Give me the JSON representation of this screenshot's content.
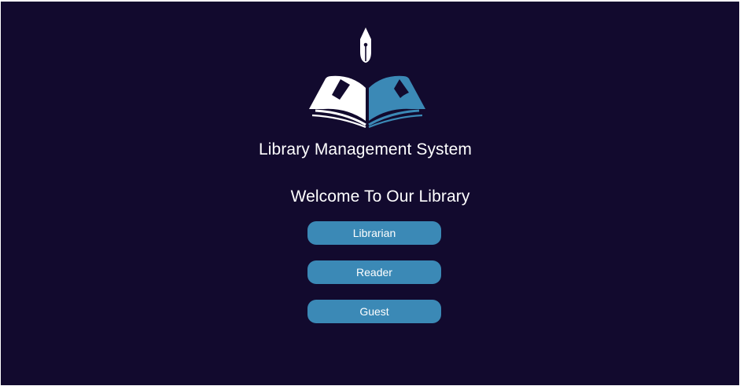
{
  "colors": {
    "background": "#120a2e",
    "accent": "#3b89b6",
    "text": "#ffffff"
  },
  "logo": {
    "icon": "open-book-with-fountain-pen-icon"
  },
  "header": {
    "title": "Library Management System"
  },
  "main": {
    "welcome": "Welcome To Our Library",
    "roles": [
      {
        "label": "Librarian"
      },
      {
        "label": "Reader"
      },
      {
        "label": "Guest"
      }
    ]
  }
}
